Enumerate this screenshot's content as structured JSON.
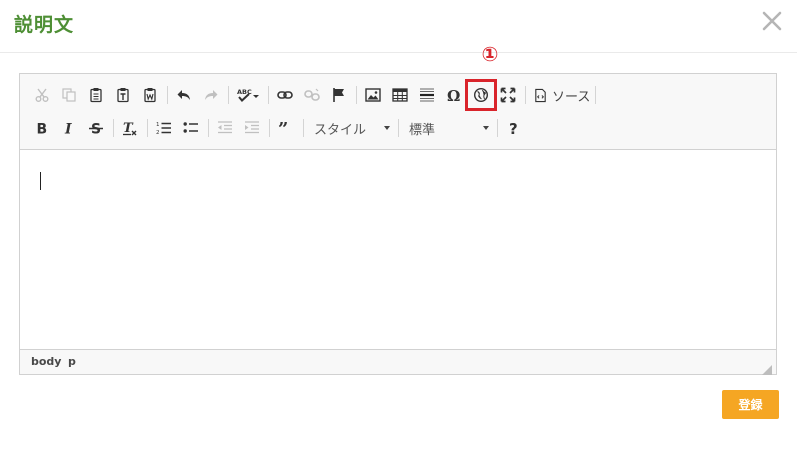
{
  "modal": {
    "title": "説明文",
    "close_icon": "close-icon",
    "submit_label": "登録"
  },
  "annotation": {
    "marker": "①",
    "color": "#d9242b"
  },
  "toolbar": {
    "row1": [
      {
        "icon": "cut-icon",
        "enabled": false
      },
      {
        "icon": "copy-icon",
        "enabled": false
      },
      {
        "icon": "paste-icon",
        "enabled": true
      },
      {
        "icon": "paste-text-icon",
        "enabled": true
      },
      {
        "icon": "paste-from-word-icon",
        "enabled": true
      },
      {
        "icon": "undo-icon",
        "enabled": true
      },
      {
        "icon": "redo-icon",
        "enabled": false
      },
      {
        "icon": "spellcheck-icon",
        "enabled": true
      },
      {
        "icon": "link-icon",
        "enabled": true
      },
      {
        "icon": "unlink-icon",
        "enabled": false
      },
      {
        "icon": "anchor-flag-icon",
        "enabled": true
      },
      {
        "icon": "image-icon",
        "enabled": true
      },
      {
        "icon": "table-icon",
        "enabled": true
      },
      {
        "icon": "horizontal-line-icon",
        "enabled": true
      },
      {
        "icon": "special-char-icon",
        "enabled": true
      },
      {
        "icon": "globe-icon",
        "enabled": true,
        "highlighted": true
      },
      {
        "icon": "maximize-icon",
        "enabled": true
      }
    ],
    "source_label": "ソース",
    "row2": [
      {
        "icon": "bold-icon",
        "enabled": true
      },
      {
        "icon": "italic-icon",
        "enabled": true
      },
      {
        "icon": "strikethrough-icon",
        "enabled": true
      },
      {
        "icon": "remove-format-icon",
        "enabled": true
      },
      {
        "icon": "numbered-list-icon",
        "enabled": true
      },
      {
        "icon": "bulleted-list-icon",
        "enabled": true
      },
      {
        "icon": "outdent-icon",
        "enabled": false
      },
      {
        "icon": "indent-icon",
        "enabled": false
      },
      {
        "icon": "blockquote-icon",
        "enabled": true
      },
      {
        "icon": "help-icon",
        "enabled": true
      }
    ],
    "styles_label": "スタイル",
    "format_label": "標準"
  },
  "statusbar": {
    "path": [
      "body",
      "p"
    ]
  },
  "colors": {
    "accent_green": "#4e8f35",
    "button_orange": "#f5a623",
    "highlight_red": "#d9242b"
  }
}
